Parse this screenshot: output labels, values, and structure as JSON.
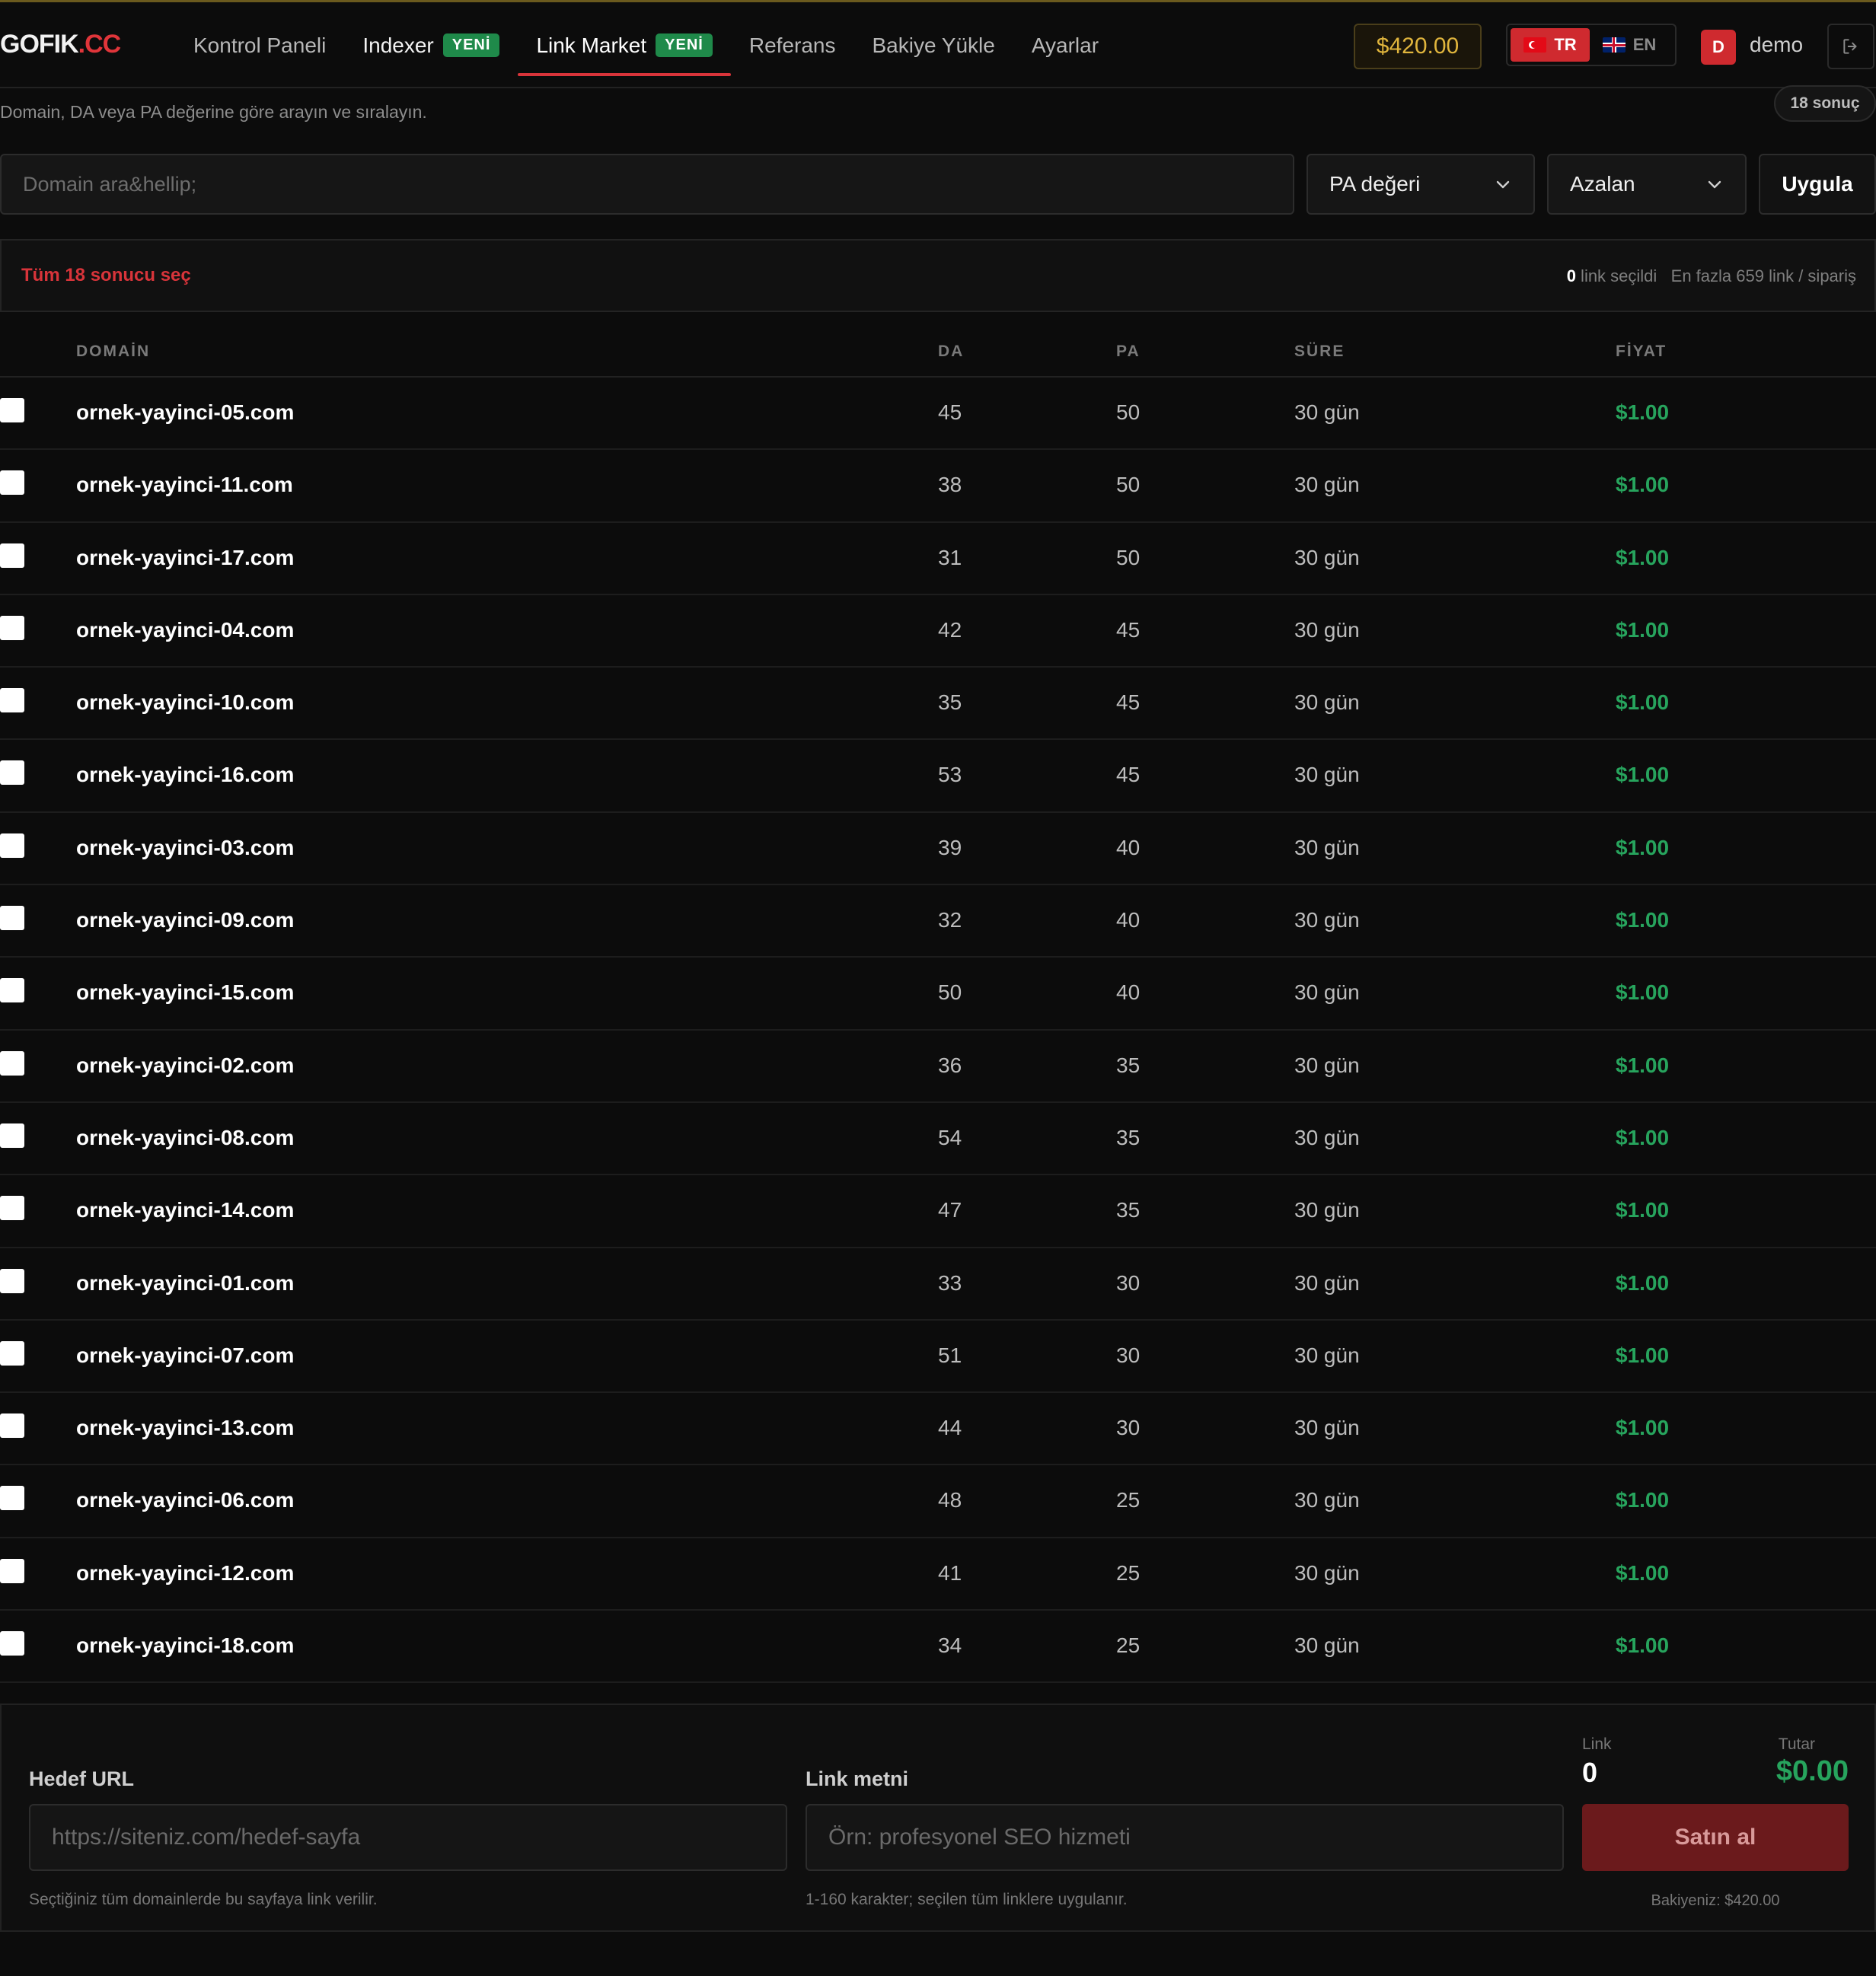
{
  "brand": {
    "name": "GOFIK",
    "tld": ".CC"
  },
  "nav": [
    {
      "label": "Kontrol Paneli",
      "badge": ""
    },
    {
      "label": "Indexer",
      "badge": "YENİ"
    },
    {
      "label": "Link Market",
      "badge": "YENİ",
      "active": true
    },
    {
      "label": "Referans",
      "badge": ""
    },
    {
      "label": "Bakiye Yükle",
      "badge": ""
    },
    {
      "label": "Ayarlar",
      "badge": ""
    }
  ],
  "header": {
    "balance": "$420.00",
    "lang_tr": "TR",
    "lang_en": "EN",
    "avatar_initial": "D",
    "username": "demo"
  },
  "page": {
    "subtitle": "Domain, DA veya PA değerine göre arayın ve sıralayın.",
    "result_count": "18 sonuç"
  },
  "filters": {
    "search_placeholder": "Domain ara&hellip;",
    "sort_field": "PA değeri",
    "sort_order": "Azalan",
    "apply_label": "Uygula"
  },
  "selection": {
    "select_all": "Tüm 18 sonucu seç",
    "selected_count": "0",
    "selected_suffix": " link seçildi",
    "limit": "En fazla 659 link / sipariş"
  },
  "table": {
    "headers": {
      "domain": "DOMAİN",
      "da": "DA",
      "pa": "PA",
      "sure": "SÜRE",
      "price": "FİYAT"
    },
    "rows": [
      {
        "domain": "ornek-yayinci-05.com",
        "da": "45",
        "pa": "50",
        "sure": "30 gün",
        "price": "$1.00"
      },
      {
        "domain": "ornek-yayinci-11.com",
        "da": "38",
        "pa": "50",
        "sure": "30 gün",
        "price": "$1.00"
      },
      {
        "domain": "ornek-yayinci-17.com",
        "da": "31",
        "pa": "50",
        "sure": "30 gün",
        "price": "$1.00"
      },
      {
        "domain": "ornek-yayinci-04.com",
        "da": "42",
        "pa": "45",
        "sure": "30 gün",
        "price": "$1.00"
      },
      {
        "domain": "ornek-yayinci-10.com",
        "da": "35",
        "pa": "45",
        "sure": "30 gün",
        "price": "$1.00"
      },
      {
        "domain": "ornek-yayinci-16.com",
        "da": "53",
        "pa": "45",
        "sure": "30 gün",
        "price": "$1.00"
      },
      {
        "domain": "ornek-yayinci-03.com",
        "da": "39",
        "pa": "40",
        "sure": "30 gün",
        "price": "$1.00"
      },
      {
        "domain": "ornek-yayinci-09.com",
        "da": "32",
        "pa": "40",
        "sure": "30 gün",
        "price": "$1.00"
      },
      {
        "domain": "ornek-yayinci-15.com",
        "da": "50",
        "pa": "40",
        "sure": "30 gün",
        "price": "$1.00"
      },
      {
        "domain": "ornek-yayinci-02.com",
        "da": "36",
        "pa": "35",
        "sure": "30 gün",
        "price": "$1.00"
      },
      {
        "domain": "ornek-yayinci-08.com",
        "da": "54",
        "pa": "35",
        "sure": "30 gün",
        "price": "$1.00"
      },
      {
        "domain": "ornek-yayinci-14.com",
        "da": "47",
        "pa": "35",
        "sure": "30 gün",
        "price": "$1.00"
      },
      {
        "domain": "ornek-yayinci-01.com",
        "da": "33",
        "pa": "30",
        "sure": "30 gün",
        "price": "$1.00"
      },
      {
        "domain": "ornek-yayinci-07.com",
        "da": "51",
        "pa": "30",
        "sure": "30 gün",
        "price": "$1.00"
      },
      {
        "domain": "ornek-yayinci-13.com",
        "da": "44",
        "pa": "30",
        "sure": "30 gün",
        "price": "$1.00"
      },
      {
        "domain": "ornek-yayinci-06.com",
        "da": "48",
        "pa": "25",
        "sure": "30 gün",
        "price": "$1.00"
      },
      {
        "domain": "ornek-yayinci-12.com",
        "da": "41",
        "pa": "25",
        "sure": "30 gün",
        "price": "$1.00"
      },
      {
        "domain": "ornek-yayinci-18.com",
        "da": "34",
        "pa": "25",
        "sure": "30 gün",
        "price": "$1.00"
      }
    ]
  },
  "order": {
    "target_label": "Hedef URL",
    "target_placeholder": "https://siteniz.com/hedef-sayfa",
    "target_hint": "Seçtiğiniz tüm domainlerde bu sayfaya link verilir.",
    "anchor_label": "Link metni",
    "anchor_placeholder": "Örn: profesyonel SEO hizmeti",
    "anchor_hint": "1-160 karakter; seçilen tüm linklere uygulanır.",
    "link_label": "Link",
    "link_count": "0",
    "total_label": "Tutar",
    "total": "$0.00",
    "buy_label": "Satın al",
    "balance_note": "Bakiyeniz: $420.00"
  },
  "colors": {
    "accent": "#d8343a",
    "price": "#27a45d",
    "balance": "#e0b53d",
    "badge": "#1f8a4a"
  }
}
